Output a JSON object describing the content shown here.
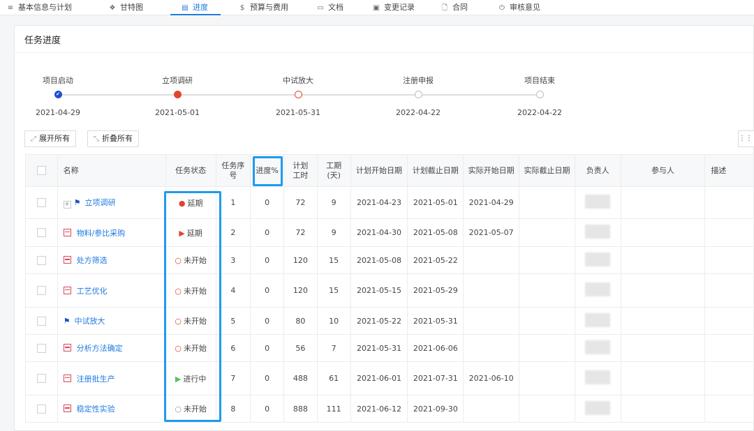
{
  "tabs": [
    {
      "label": "基本信息与计划",
      "icon": "≡"
    },
    {
      "label": "甘特图",
      "icon": "❖"
    },
    {
      "label": "进度",
      "icon": "▤"
    },
    {
      "label": "预算与费用",
      "icon": "$"
    },
    {
      "label": "文档",
      "icon": "▭"
    },
    {
      "label": "变更记录",
      "icon": "▣"
    },
    {
      "label": "合同",
      "icon": "🗋"
    },
    {
      "label": "审核意见",
      "icon": "⏻"
    }
  ],
  "active_tab": "进度",
  "panel": {
    "title": "任务进度"
  },
  "milestones": [
    {
      "name": "项目启动",
      "date": "2021-04-29",
      "state": "done"
    },
    {
      "name": "立项调研",
      "date": "2021-05-01",
      "state": "delayed"
    },
    {
      "name": "中试放大",
      "date": "2021-05-31",
      "state": "pending-red"
    },
    {
      "name": "注册申报",
      "date": "2022-04-22",
      "state": "pending-gray"
    },
    {
      "name": "项目结束",
      "date": "2022-04-22",
      "state": "pending-gray"
    }
  ],
  "toolbar": {
    "expand_all": "展开所有",
    "collapse_all": "折叠所有"
  },
  "columns": {
    "name": "名称",
    "status": "任务状态",
    "seq": "任务序号",
    "progress": "进度%",
    "plan_hours": "计划工时",
    "duration": "工期(天)",
    "plan_start": "计划开始日期",
    "plan_end": "计划截止日期",
    "actual_start": "实际开始日期",
    "actual_end": "实际截止日期",
    "owner": "负责人",
    "participants": "参与人",
    "description": "描述"
  },
  "rows": [
    {
      "name": "立项调研",
      "type": "milestone",
      "expandable": true,
      "status": "延期",
      "status_icon": "●",
      "status_color": "#e2452c",
      "seq": "1",
      "progress": "0",
      "plan_hours": "72",
      "duration": "9",
      "plan_start": "2021-04-23",
      "plan_end": "2021-05-01",
      "actual_start": "2021-04-29",
      "actual_end": ""
    },
    {
      "name": "物料/参比采购",
      "type": "task",
      "expandable": false,
      "status": "延期",
      "status_icon": "▶",
      "status_color": "#e2452c",
      "seq": "2",
      "progress": "0",
      "plan_hours": "72",
      "duration": "9",
      "plan_start": "2021-04-30",
      "plan_end": "2021-05-08",
      "actual_start": "2021-05-07",
      "actual_end": ""
    },
    {
      "name": "处方筛选",
      "type": "task",
      "expandable": false,
      "status": "未开始",
      "status_icon": "○",
      "status_color": "#e2452c",
      "seq": "3",
      "progress": "0",
      "plan_hours": "120",
      "duration": "15",
      "plan_start": "2021-05-08",
      "plan_end": "2021-05-22",
      "actual_start": "",
      "actual_end": ""
    },
    {
      "name": "工艺优化",
      "type": "task",
      "expandable": false,
      "status": "未开始",
      "status_icon": "○",
      "status_color": "#e2452c",
      "seq": "4",
      "progress": "0",
      "plan_hours": "120",
      "duration": "15",
      "plan_start": "2021-05-15",
      "plan_end": "2021-05-29",
      "actual_start": "",
      "actual_end": ""
    },
    {
      "name": "中试放大",
      "type": "milestone",
      "expandable": false,
      "status": "未开始",
      "status_icon": "○",
      "status_color": "#e2452c",
      "seq": "5",
      "progress": "0",
      "plan_hours": "80",
      "duration": "10",
      "plan_start": "2021-05-22",
      "plan_end": "2021-05-31",
      "actual_start": "",
      "actual_end": ""
    },
    {
      "name": "分析方法确定",
      "type": "task",
      "expandable": false,
      "status": "未开始",
      "status_icon": "○",
      "status_color": "#e2452c",
      "seq": "6",
      "progress": "0",
      "plan_hours": "56",
      "duration": "7",
      "plan_start": "2021-05-31",
      "plan_end": "2021-06-06",
      "actual_start": "",
      "actual_end": ""
    },
    {
      "name": "注册批生产",
      "type": "task",
      "expandable": false,
      "status": "进行中",
      "status_icon": "▶",
      "status_color": "#5cc05c",
      "seq": "7",
      "progress": "0",
      "plan_hours": "488",
      "duration": "61",
      "plan_start": "2021-06-01",
      "plan_end": "2021-07-31",
      "actual_start": "2021-06-10",
      "actual_end": ""
    },
    {
      "name": "稳定性实验",
      "type": "task",
      "expandable": false,
      "status": "未开始",
      "status_icon": "○",
      "status_color": "#999999",
      "seq": "8",
      "progress": "0",
      "plan_hours": "888",
      "duration": "111",
      "plan_start": "2021-06-12",
      "plan_end": "2021-09-30",
      "actual_start": "",
      "actual_end": ""
    }
  ],
  "colors": {
    "accent": "#1f7ae0",
    "highlight": "#1e9af0",
    "delayed": "#e2452c",
    "in_progress": "#5cc05c"
  }
}
